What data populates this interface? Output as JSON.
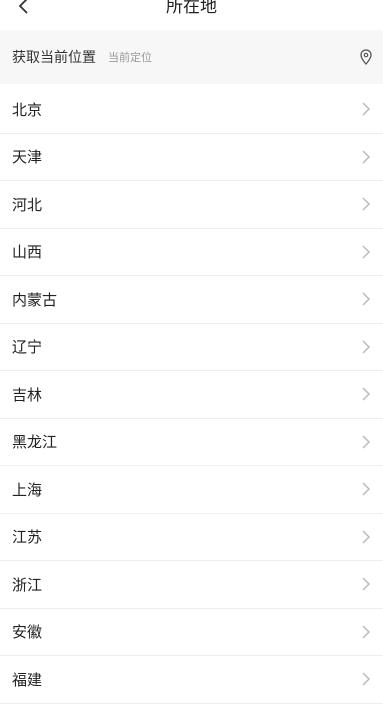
{
  "header": {
    "title": "所在地",
    "back_icon": "chevron-left-icon"
  },
  "location": {
    "title": "获取当前位置",
    "subtitle": "当前定位",
    "icon": "map-pin-icon"
  },
  "list": {
    "items": [
      {
        "label": "北京"
      },
      {
        "label": "天津"
      },
      {
        "label": "河北"
      },
      {
        "label": "山西"
      },
      {
        "label": "内蒙古"
      },
      {
        "label": "辽宁"
      },
      {
        "label": "吉林"
      },
      {
        "label": "黑龙江"
      },
      {
        "label": "上海"
      },
      {
        "label": "江苏"
      },
      {
        "label": "浙江"
      },
      {
        "label": "安徽"
      },
      {
        "label": "福建"
      }
    ],
    "chevron_icon": "chevron-right-icon"
  }
}
